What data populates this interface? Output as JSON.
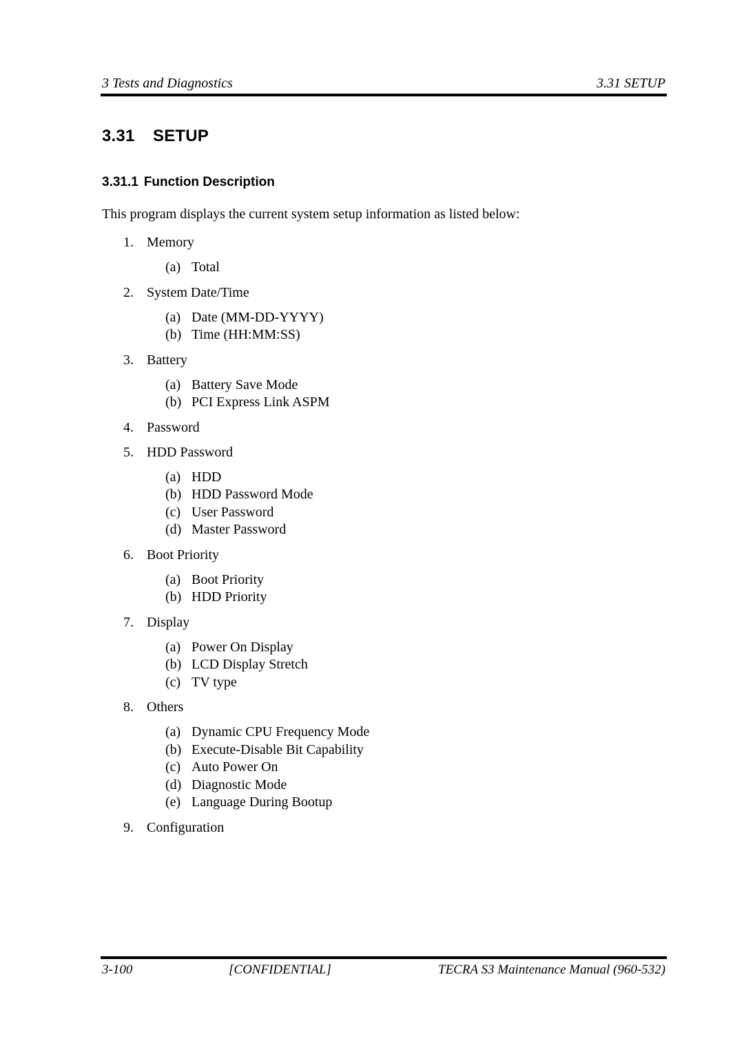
{
  "header": {
    "chapter": "3 Tests and Diagnostics",
    "section": "3.31  SETUP"
  },
  "section": {
    "number": "3.31",
    "title": "SETUP"
  },
  "subsection": {
    "number": "3.31.1",
    "title": "Function Description"
  },
  "intro": "This program displays the current system setup information as listed below:",
  "items": [
    {
      "num": "1.",
      "label": "Memory",
      "subs": [
        {
          "letter": "(a)",
          "label": "Total"
        }
      ]
    },
    {
      "num": "2.",
      "label": "System Date/Time",
      "subs": [
        {
          "letter": "(a)",
          "label": "Date (MM-DD-YYYY)"
        },
        {
          "letter": "(b)",
          "label": "Time (HH:MM:SS)"
        }
      ]
    },
    {
      "num": "3.",
      "label": "Battery",
      "subs": [
        {
          "letter": "(a)",
          "label": "Battery Save Mode"
        },
        {
          "letter": "(b)",
          "label": "PCI Express Link ASPM"
        }
      ]
    },
    {
      "num": "4.",
      "label": "Password",
      "subs": []
    },
    {
      "num": "5.",
      "label": "HDD Password",
      "subs": [
        {
          "letter": "(a)",
          "label": "HDD"
        },
        {
          "letter": "(b)",
          "label": "HDD Password Mode"
        },
        {
          "letter": "(c)",
          "label": "User Password"
        },
        {
          "letter": "(d)",
          "label": "Master Password"
        }
      ]
    },
    {
      "num": "6.",
      "label": "Boot Priority",
      "subs": [
        {
          "letter": "(a)",
          "label": "Boot Priority"
        },
        {
          "letter": "(b)",
          "label": "HDD Priority"
        }
      ]
    },
    {
      "num": "7.",
      "label": "Display",
      "subs": [
        {
          "letter": "(a)",
          "label": "Power On Display"
        },
        {
          "letter": "(b)",
          "label": "LCD Display Stretch"
        },
        {
          "letter": "(c)",
          "label": "TV type"
        }
      ]
    },
    {
      "num": "8.",
      "label": "Others",
      "subs": [
        {
          "letter": "(a)",
          "label": "Dynamic CPU Frequency Mode"
        },
        {
          "letter": "(b)",
          "label": "Execute-Disable Bit Capability"
        },
        {
          "letter": "(c)",
          "label": "Auto Power On"
        },
        {
          "letter": "(d)",
          "label": "Diagnostic Mode"
        },
        {
          "letter": "(e)",
          "label": "Language During Bootup"
        }
      ]
    },
    {
      "num": "9.",
      "label": "Configuration",
      "subs": []
    }
  ],
  "footer": {
    "page_number": "3-100",
    "confidential": "[CONFIDENTIAL]",
    "manual": "TECRA S3 Maintenance Manual (960-532)"
  }
}
